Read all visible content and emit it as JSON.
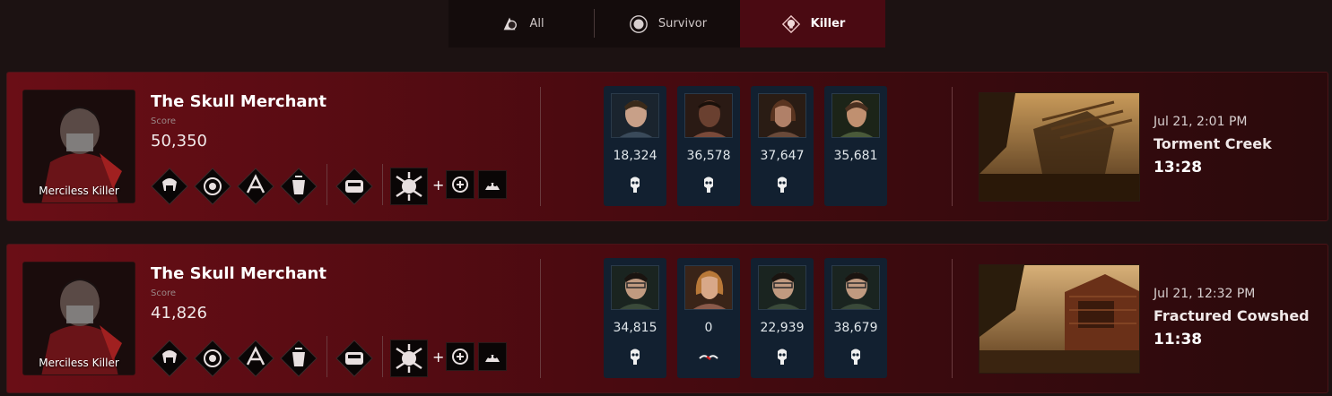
{
  "tabs": [
    {
      "label": "All",
      "icon": "all-roles-icon"
    },
    {
      "label": "Survivor",
      "icon": "survivor-icon"
    },
    {
      "label": "Killer",
      "icon": "killer-icon",
      "active": true
    }
  ],
  "colors": {
    "accent": "#4a0a12",
    "survivor_card": "#122030",
    "row_bg": "#5a0c14"
  },
  "matches": [
    {
      "killer": "The Skull Merchant",
      "score_label": "Score",
      "score": "50,350",
      "grade": "Merciless Killer",
      "perks": [
        "perk-1-icon",
        "perk-2-icon",
        "perk-3-icon",
        "perk-4-icon"
      ],
      "offering": "offering-icon",
      "power": "power-icon",
      "addons": [
        "addon-1-icon",
        "addon-2-icon"
      ],
      "plus": "+",
      "survivors": [
        {
          "score": "18,324",
          "status": "sacrificed"
        },
        {
          "score": "36,578",
          "status": "sacrificed"
        },
        {
          "score": "37,647",
          "status": "sacrificed"
        },
        {
          "score": "35,681",
          "status": "none"
        }
      ],
      "date": "Jul 21, 2:01 PM",
      "map": "Torment Creek",
      "duration": "13:28"
    },
    {
      "killer": "The Skull Merchant",
      "score_label": "Score",
      "score": "41,826",
      "grade": "Merciless Killer",
      "perks": [
        "perk-1-icon",
        "perk-2-icon",
        "perk-3-icon",
        "perk-4-icon"
      ],
      "offering": "offering-icon",
      "power": "power-icon",
      "addons": [
        "addon-1-icon",
        "addon-2-icon"
      ],
      "plus": "+",
      "survivors": [
        {
          "score": "34,815",
          "status": "sacrificed"
        },
        {
          "score": "0",
          "status": "disconnected"
        },
        {
          "score": "22,939",
          "status": "sacrificed"
        },
        {
          "score": "38,679",
          "status": "sacrificed"
        }
      ],
      "date": "Jul 21, 12:32 PM",
      "map": "Fractured Cowshed",
      "duration": "11:38"
    }
  ]
}
